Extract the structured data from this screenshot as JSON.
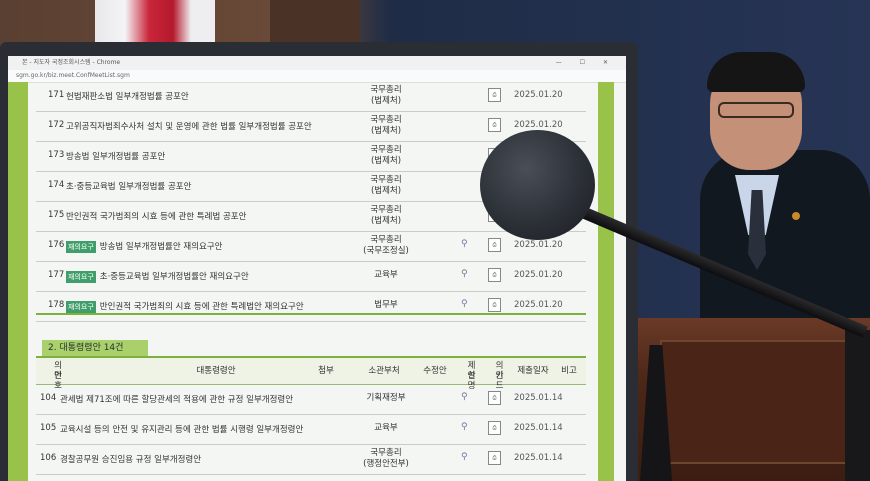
{
  "browser": {
    "tab_title": "본 - 지도자 국정조회시스템 - Chrome",
    "url": "sgm.go.kr/biz.meet.ConfMeetList.sgm",
    "window_controls": "— ☐ ✕"
  },
  "bills": [
    {
      "num": "171",
      "badge": "",
      "title": "헌법재판소법 일부개정법률 공포안",
      "dept1": "국무총리",
      "dept2": "(법제처)",
      "date": "2025.01.20"
    },
    {
      "num": "172",
      "badge": "",
      "title": "고위공직자범죄수사처 설치 및 운영에 관한 법률 일부개정법률 공포안",
      "dept1": "국무총리",
      "dept2": "(법제처)",
      "date": "2025.01.20"
    },
    {
      "num": "173",
      "badge": "",
      "title": "방송법 일부개정법률 공포안",
      "dept1": "국무총리",
      "dept2": "(법제처)",
      "date": ""
    },
    {
      "num": "174",
      "badge": "",
      "title": "초·중등교육법 일부개정법률 공포안",
      "dept1": "국무총리",
      "dept2": "(법제처)",
      "date": ""
    },
    {
      "num": "175",
      "badge": "",
      "title": "반인권적 국가범죄의 시효 등에 관한 특례법 공포안",
      "dept1": "국무총리",
      "dept2": "(법제처)",
      "date": ""
    },
    {
      "num": "176",
      "badge": "재의요구",
      "title": "방송법 일부개정법률안 재의요구안",
      "dept1": "국무총리",
      "dept2": "(국무조정실)",
      "date": "2025.01.20"
    },
    {
      "num": "177",
      "badge": "재의요구",
      "title": "초·중등교육법 일부개정법률안 재의요구안",
      "dept1": "교육부",
      "dept2": "",
      "date": "2025.01.20"
    },
    {
      "num": "178",
      "badge": "재의요구",
      "title": "반인권적 국가범죄의 시효 등에 관한 특례법안 재의요구안",
      "dept1": "법무부",
      "dept2": "",
      "date": "2025.01.20"
    }
  ],
  "section": {
    "title": "2. 대통령령안 14건"
  },
  "table_header": {
    "no_1": "의안",
    "no_2": "번호",
    "title": "대통령령안",
    "attach": "첨부",
    "dept": "소관부처",
    "revision": "수정안",
    "proposal_1": "제안",
    "proposal_2": "설명",
    "code_1": "의안",
    "code_2": "키드",
    "date": "제출일자",
    "note": "비고"
  },
  "decrees": [
    {
      "num": "104",
      "title": "관세법 제71조에 따른 할당관세의 적용에 관한 규정 일부개정령안",
      "dept1": "기획재정부",
      "dept2": "",
      "date": "2025.01.14"
    },
    {
      "num": "105",
      "title": "교육시설 등의 안전 및 유지관리 등에 관한 법률 시행령 일부개정령안",
      "dept1": "교육부",
      "dept2": "",
      "date": "2025.01.14"
    },
    {
      "num": "106",
      "title": "경찰공무원 승진임용 규정 일부개정령안",
      "dept1": "국무총리",
      "dept2": "(행정안전부)",
      "date": "2025.01.14"
    }
  ]
}
